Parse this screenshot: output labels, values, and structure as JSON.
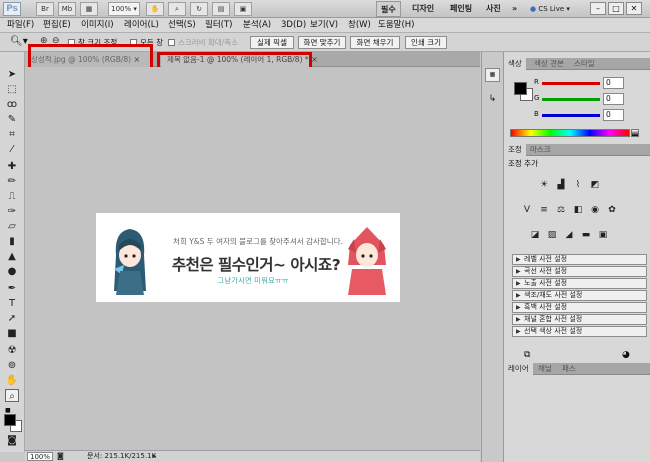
{
  "appbar": {
    "logo": "Ps",
    "buttons": [
      "Br",
      "Mb"
    ],
    "zoom": "100%",
    "workspaces": [
      "필수",
      "디자인",
      "페인팅",
      "사진"
    ],
    "more": "»",
    "cslive": "CS Live",
    "win_min": "–",
    "win_max": "□",
    "win_close": "✕"
  },
  "menu": [
    "파일(F)",
    "편집(E)",
    "이미지(I)",
    "레이어(L)",
    "선택(S)",
    "필터(T)",
    "분석(A)",
    "3D(D)",
    "보기(V)",
    "창(W)",
    "도움말(H)"
  ],
  "options": {
    "resize_windows": "창 크기 조정",
    "all_windows": "모든 창",
    "scrubby_zoom": "스크러비 확대/축소",
    "actual_pixels": "실제 픽셀",
    "fit_screen": "화면 맞추기",
    "fill_screen": "화면 채우기",
    "print_size": "인쇄 크기"
  },
  "tabs": [
    {
      "label": "상성적.jpg @ 100% (RGB/8)",
      "close": "×"
    },
    {
      "label": "제목 없음-1 @ 100% (레이어 1, RGB/8) *",
      "close": "×"
    }
  ],
  "banner": {
    "line1": "처희 Y&S 두 여자의 블로그를 찾아주셔서 감사합니다.",
    "line2": "추천은 필수인거~ 아시죠?",
    "line3": "그냥가시면 미워요ㅠㅠ"
  },
  "status": {
    "zoom": "100%",
    "doc": "문서: 215.1K/215.1K"
  },
  "color_panel": {
    "tabs": [
      "색상",
      "색상 견본",
      "스타일"
    ],
    "channels": [
      {
        "label": "R",
        "value": "0",
        "color": "#d40000"
      },
      {
        "label": "G",
        "value": "0",
        "color": "#00a000"
      },
      {
        "label": "B",
        "value": "0",
        "color": "#0000d0"
      }
    ]
  },
  "adjust_panel": {
    "tabs": [
      "조정",
      "마스크"
    ],
    "title": "조정 추가",
    "presets": [
      "레벨 사전 설정",
      "곡선 사전 설정",
      "노출 사전 설정",
      "색조/채도 사전 설정",
      "흑백 사전 설정",
      "채널 혼합 사전 설정",
      "선택 색상 사전 설정"
    ]
  },
  "layers_panel": {
    "tabs": [
      "레이어",
      "채널",
      "패스"
    ]
  }
}
